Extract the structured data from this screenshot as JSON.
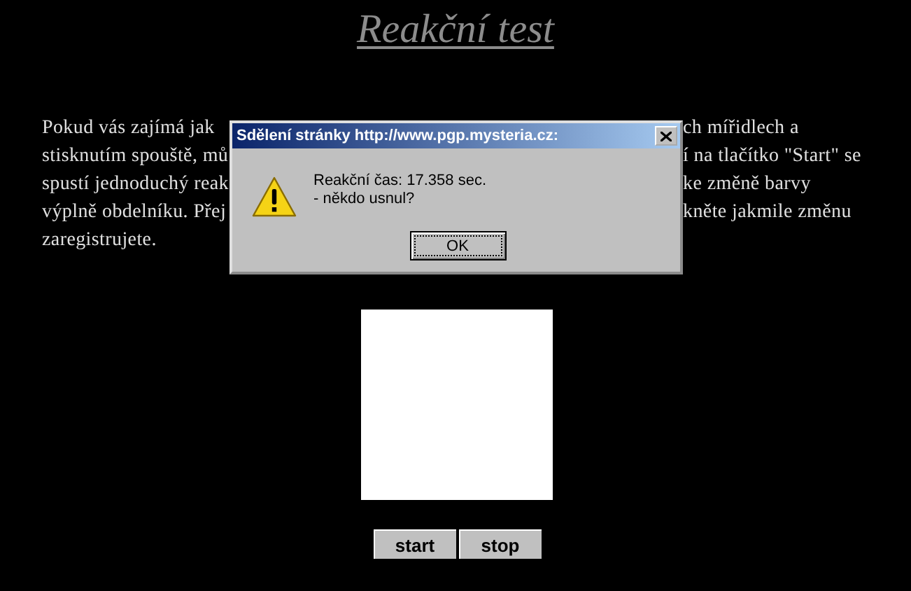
{
  "page": {
    "title": "Reakční test",
    "intro_lines": [
      {
        "left": "Pokud vás zajímá jak",
        "right": "ch mířidlech a"
      },
      {
        "left": "stisknutím spouště, mů",
        "right": "í na tlačítko \"Start\" se"
      },
      {
        "left": "spustí jednoduchý reak",
        "right": "ke změně barvy"
      },
      {
        "left": "výplně obdelníku. Přej",
        "right": "kněte jakmile změnu"
      },
      {
        "left": "zaregistrujete."
      }
    ],
    "buttons": [
      "start",
      "stop"
    ]
  },
  "dialog": {
    "title": "Sdělení stránky http://www.pgp.mysteria.cz:",
    "message_lines": [
      "Reakční čas: 17.358 sec.",
      "- někdo usnul?"
    ],
    "button": "OK"
  }
}
